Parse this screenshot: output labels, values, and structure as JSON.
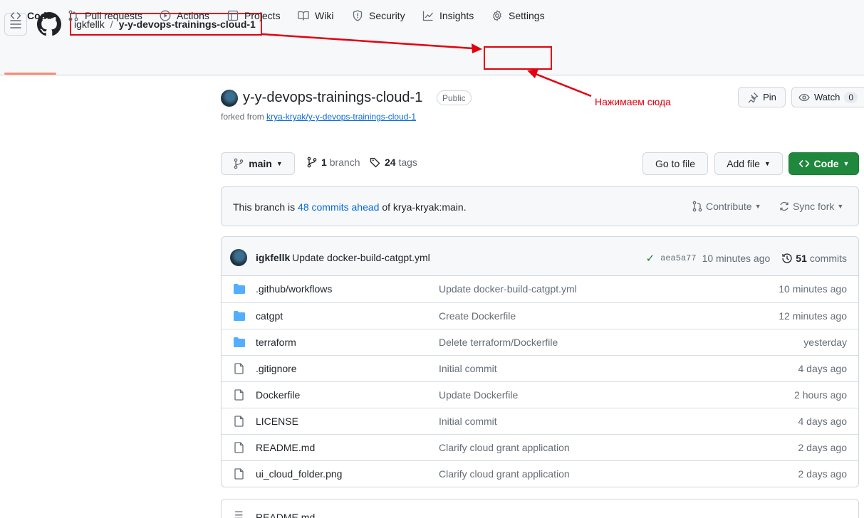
{
  "header": {
    "owner": "igkfellk",
    "separator": "/",
    "repo": "y-y-devops-trainings-cloud-1"
  },
  "tabs": [
    {
      "label": "Code",
      "icon": "code-icon"
    },
    {
      "label": "Pull requests",
      "icon": "pull-request-icon"
    },
    {
      "label": "Actions",
      "icon": "play-icon"
    },
    {
      "label": "Projects",
      "icon": "table-icon"
    },
    {
      "label": "Wiki",
      "icon": "book-icon"
    },
    {
      "label": "Security",
      "icon": "shield-icon"
    },
    {
      "label": "Insights",
      "icon": "graph-icon"
    },
    {
      "label": "Settings",
      "icon": "gear-icon"
    }
  ],
  "annotation": "Нажимаем сюда",
  "repo": {
    "title": "y-y-devops-trainings-cloud-1",
    "visibility": "Public",
    "forked_prefix": "forked from ",
    "forked_link": "krya-kryak/y-y-devops-trainings-cloud-1",
    "pin_label": "Pin",
    "watch_label": "Watch",
    "watch_count": "0"
  },
  "branchbar": {
    "branch": "main",
    "branch_count": "1",
    "branch_label": "branch",
    "tag_count": "24",
    "tag_label": "tags",
    "goto_file": "Go to file",
    "add_file": "Add file",
    "code": "Code"
  },
  "ahead": {
    "prefix": "This branch is ",
    "link": "48 commits ahead",
    "suffix": " of krya-kryak:main.",
    "contribute": "Contribute",
    "sync": "Sync fork"
  },
  "commit": {
    "author": "igkfellk",
    "message": "Update docker-build-catgpt.yml",
    "sha": "aea5a77",
    "time": "10 minutes ago",
    "count": "51",
    "count_label": "commits"
  },
  "files": [
    {
      "name": ".github/workflows",
      "type": "folder",
      "commit": "Update docker-build-catgpt.yml",
      "age": "10 minutes ago"
    },
    {
      "name": "catgpt",
      "type": "folder",
      "commit": "Create Dockerfile",
      "age": "12 minutes ago"
    },
    {
      "name": "terraform",
      "type": "folder",
      "commit": "Delete terraform/Dockerfile",
      "age": "yesterday"
    },
    {
      "name": ".gitignore",
      "type": "file",
      "commit": "Initial commit",
      "age": "4 days ago"
    },
    {
      "name": "Dockerfile",
      "type": "file",
      "commit": "Update Dockerfile",
      "age": "2 hours ago"
    },
    {
      "name": "LICENSE",
      "type": "file",
      "commit": "Initial commit",
      "age": "4 days ago"
    },
    {
      "name": "README.md",
      "type": "file",
      "commit": "Clarify cloud grant application",
      "age": "2 days ago"
    },
    {
      "name": "ui_cloud_folder.png",
      "type": "file",
      "commit": "Clarify cloud grant application",
      "age": "2 days ago"
    }
  ],
  "readme": {
    "label": "README.md"
  },
  "colors": {
    "accent_red": "#e3000f",
    "link_blue": "#0969da",
    "primary_green": "#1f883d",
    "folder_blue": "#54aeff"
  }
}
